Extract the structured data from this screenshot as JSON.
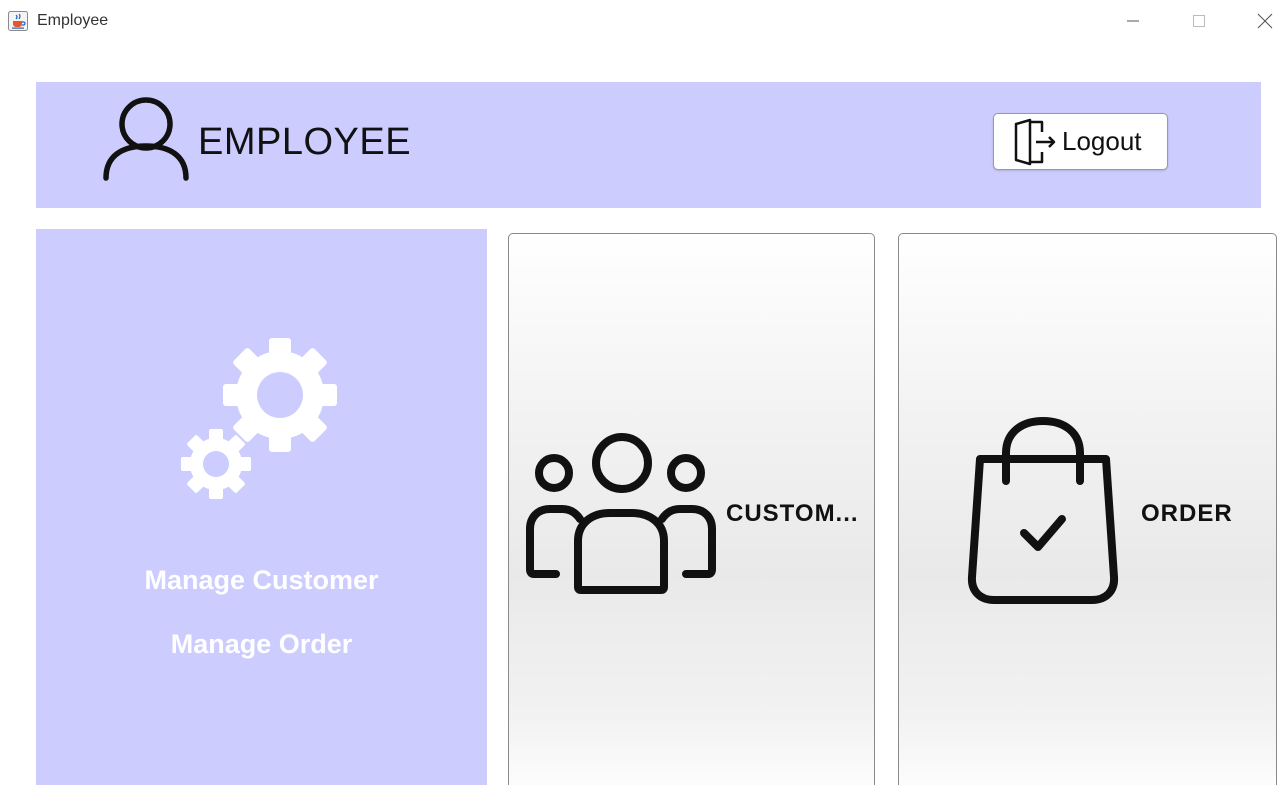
{
  "window": {
    "title": "Employee",
    "app_icon": "java-cup-icon",
    "controls": [
      "minimize-icon",
      "maximize-icon",
      "close-icon"
    ]
  },
  "header": {
    "title": "EMPLOYEE",
    "icon": "user-icon",
    "logout_label": "Logout",
    "logout_icon": "logout-door-icon",
    "background": "#ccccff"
  },
  "sidebar": {
    "icon": "gears-icon",
    "items": [
      {
        "label": "Manage Customer"
      },
      {
        "label": "Manage Order"
      }
    ],
    "background": "#ccccff",
    "text_color": "#ffffff"
  },
  "tiles": [
    {
      "label": "CUSTOM...",
      "icon": "customers-group-icon"
    },
    {
      "label": "ORDER",
      "icon": "shopping-bag-check-icon"
    }
  ]
}
